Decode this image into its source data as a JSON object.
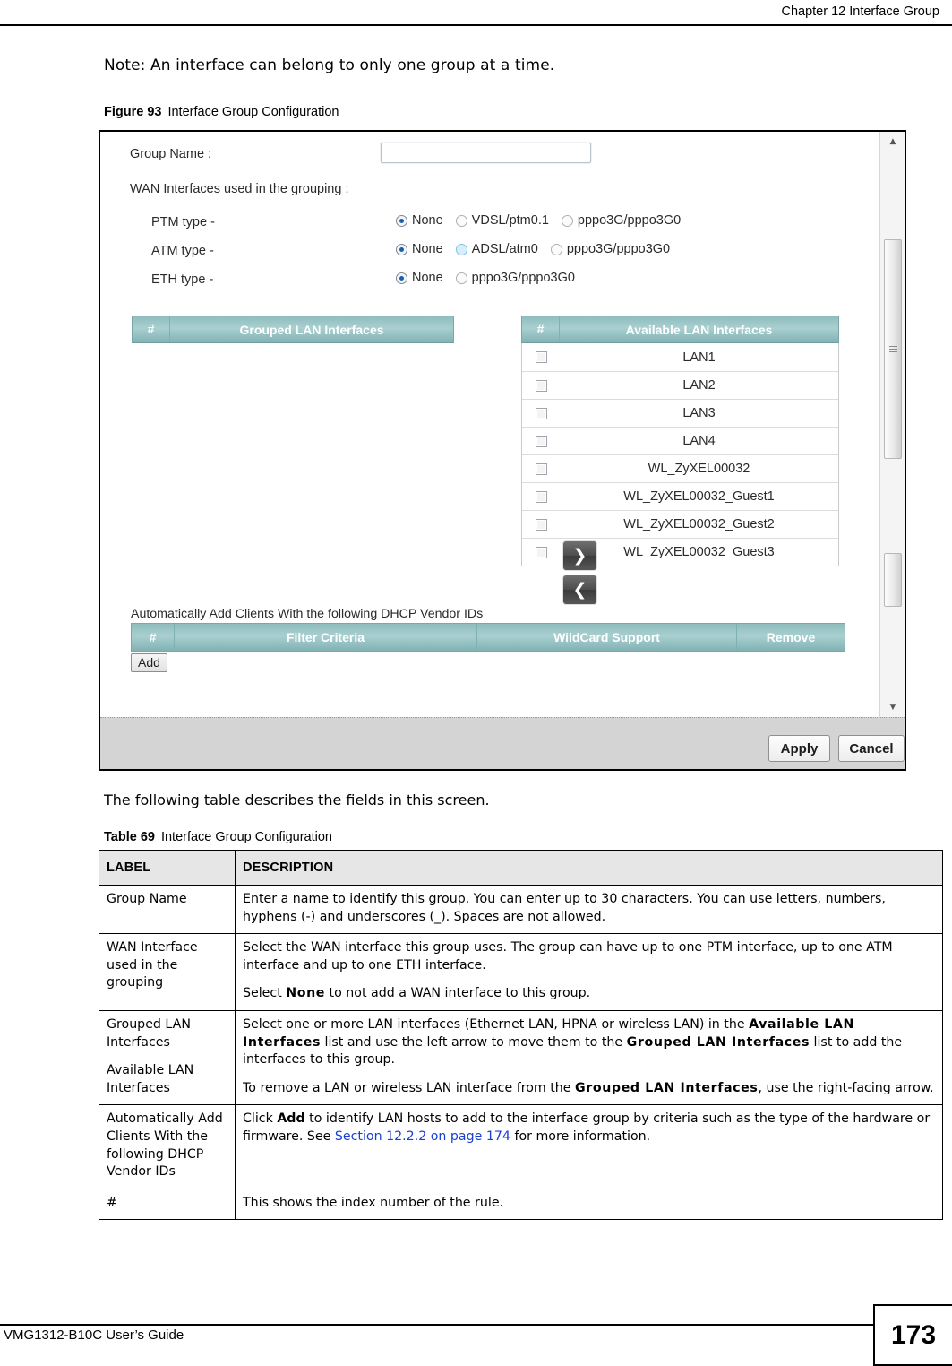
{
  "header": {
    "running_head": "Chapter 12 Interface Group"
  },
  "note": "Note: An interface can belong to only one group at a time.",
  "figure": {
    "caption_number": "Figure 93",
    "caption_text": "Interface Group Configuration",
    "screen": {
      "group_name_label": "Group Name :",
      "group_name_value": "",
      "wan_section_label": "WAN Interfaces used in the grouping :",
      "wan_types": [
        {
          "label": "PTM type -",
          "options": [
            {
              "text": "None",
              "state": "checked"
            },
            {
              "text": "VDSL/ptm0.1",
              "state": "unchecked"
            },
            {
              "text": "pppo3G/pppo3G0",
              "state": "unchecked"
            }
          ]
        },
        {
          "label": "ATM type -",
          "options": [
            {
              "text": "None",
              "state": "checked"
            },
            {
              "text": "ADSL/atm0",
              "state": "hover"
            },
            {
              "text": "pppo3G/pppo3G0",
              "state": "unchecked"
            }
          ]
        },
        {
          "label": "ETH type -",
          "options": [
            {
              "text": "None",
              "state": "checked"
            },
            {
              "text": "pppo3G/pppo3G0",
              "state": "unchecked"
            }
          ]
        }
      ],
      "grouped_table": {
        "header_num": "#",
        "header_name": "Grouped LAN Interfaces",
        "rows": []
      },
      "available_table": {
        "header_num": "#",
        "header_name": "Available LAN Interfaces",
        "rows": [
          "LAN1",
          "LAN2",
          "LAN3",
          "LAN4",
          "WL_ZyXEL00032",
          "WL_ZyXEL00032_Guest1",
          "WL_ZyXEL00032_Guest2",
          "WL_ZyXEL00032_Guest3"
        ]
      },
      "arrows": {
        "right": "❯",
        "left": "❮"
      },
      "dhcp_section_label": "Automatically Add Clients With the following DHCP Vendor IDs",
      "dhcp_table_headers": [
        "#",
        "Filter Criteria",
        "WildCard Support",
        "Remove"
      ],
      "add_button": "Add",
      "apply_button": "Apply",
      "cancel_button": "Cancel"
    }
  },
  "following_paragraph": "The following table describes the fields in this screen.",
  "table": {
    "caption_number": "Table 69",
    "caption_text": "Interface Group Configuration",
    "columns": [
      "LABEL",
      "DESCRIPTION"
    ],
    "rows": [
      {
        "label": "Group Name",
        "desc_p1": "Enter a name to identify this group. You can enter up to 30 characters. You can use letters, numbers, hyphens (-) and underscores (_). Spaces are not allowed."
      },
      {
        "label": "WAN Interface used in the grouping",
        "desc_p1": "Select the WAN interface this group uses. The group can have up to one PTM interface, up to one ATM interface and up to one ETH interface.",
        "desc_p2_a": "Select ",
        "desc_p2_b": "None",
        "desc_p2_c": " to not add a WAN interface to this group."
      },
      {
        "label": "Grouped LAN Interfaces",
        "label2": "Available LAN Interfaces",
        "desc_p1_a": "Select one or more LAN interfaces (Ethernet LAN, HPNA or wireless LAN) in the ",
        "desc_p1_b": "Available LAN Interfaces",
        "desc_p1_c": " list and use the left arrow to move them to the ",
        "desc_p1_d": "Grouped LAN Interfaces",
        "desc_p1_e": " list to add the interfaces to this group.",
        "desc_p2_a": "To remove a LAN or wireless LAN interface from the ",
        "desc_p2_b": "Grouped LAN Interfaces",
        "desc_p2_c": ", use the right-facing arrow."
      },
      {
        "label": "Automatically Add Clients With the following DHCP Vendor IDs",
        "desc_p1_a": "Click ",
        "desc_p1_b": "Add",
        "desc_p1_c": " to identify LAN hosts to add to the interface group by criteria such as the type of the hardware or firmware. See ",
        "desc_p1_link": "Section 12.2.2 on page 174",
        "desc_p1_d": " for more information."
      },
      {
        "label": "#",
        "desc_p1": "This shows the index number of the rule."
      }
    ]
  },
  "footer": {
    "guide": "VMG1312-B10C User’s Guide",
    "page_number": "173"
  }
}
